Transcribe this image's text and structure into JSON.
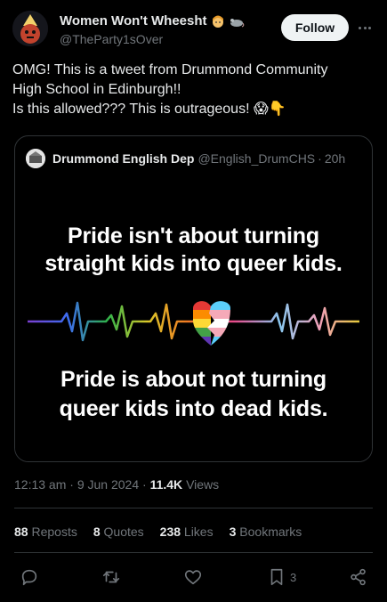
{
  "author": {
    "display_name": "Women Won't Wheesht",
    "handle": "@TheParty1sOver",
    "emoji_1": "woman-emoji-icon",
    "emoji_2": "rat-emoji-icon"
  },
  "follow_label": "Follow",
  "tweet_lines": [
    "OMG! This is a tweet from Drummond Community",
    "High School in Edinburgh!!",
    "Is this allowed??? This is outrageous! 😱👇"
  ],
  "quoted": {
    "display_name": "Drummond English Dep",
    "handle": "@English_DrumCHS",
    "separator": "·",
    "time": "20h",
    "image_lines": [
      "Pride isn't about turning",
      "straight kids into queer kids.",
      "Pride is about not turning",
      "queer kids into dead kids."
    ]
  },
  "meta": {
    "time": "12:13 am",
    "sep1": "·",
    "date": "9 Jun 2024",
    "sep2": "·",
    "views_count": "11.4K",
    "views_label": "Views"
  },
  "stats": [
    {
      "count": "88",
      "label": "Reposts"
    },
    {
      "count": "8",
      "label": "Quotes"
    },
    {
      "count": "238",
      "label": "Likes"
    },
    {
      "count": "3",
      "label": "Bookmarks"
    }
  ],
  "actions": {
    "bookmark_count": "3",
    "icons": [
      "reply-icon",
      "retweet-icon",
      "like-icon",
      "bookmark-icon",
      "share-icon"
    ]
  },
  "colors": {
    "background": "#000000",
    "text": "#e7e9ea",
    "muted": "#71767b",
    "divider": "#2f3336"
  }
}
